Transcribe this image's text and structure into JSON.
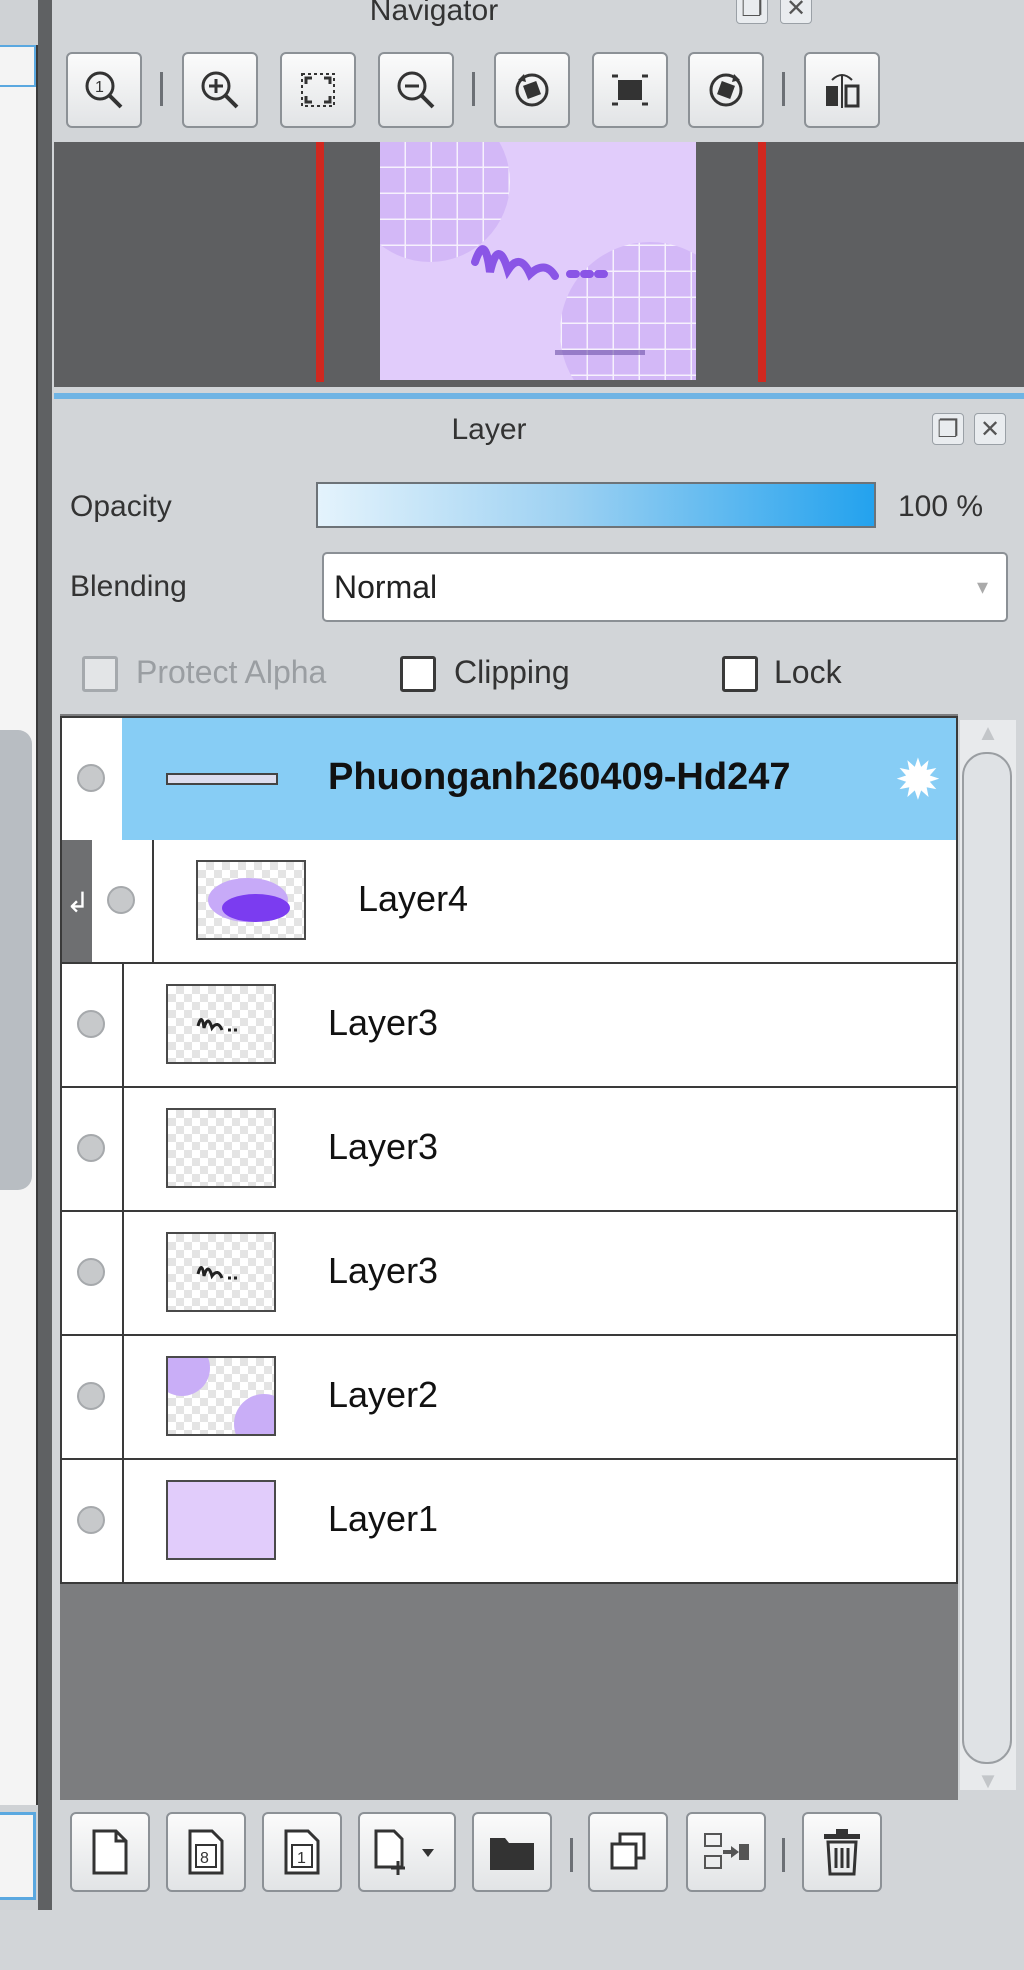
{
  "navigator": {
    "title": "Navigator",
    "toolbar": [
      {
        "name": "zoom-actual-size-icon"
      },
      {
        "name": "zoom-in-icon"
      },
      {
        "name": "fit-to-window-icon"
      },
      {
        "name": "zoom-out-icon"
      },
      {
        "name": "rotate-left-icon"
      },
      {
        "name": "reset-rotation-icon"
      },
      {
        "name": "rotate-right-icon"
      },
      {
        "name": "flip-horizontal-icon"
      }
    ]
  },
  "layer_panel": {
    "title": "Layer",
    "opacity_label": "Opacity",
    "opacity_value": "100 %",
    "opacity_fraction": 1.0,
    "blending_label": "Blending",
    "blending_value": "Normal",
    "protect_alpha_label": "Protect Alpha",
    "clipping_label": "Clipping",
    "lock_label": "Lock",
    "layers": [
      {
        "name": "Phuonganh260409-Hd247",
        "selected": true
      },
      {
        "name": "Layer4",
        "clipped": true
      },
      {
        "name": "Layer3"
      },
      {
        "name": "Layer3"
      },
      {
        "name": "Layer3"
      },
      {
        "name": "Layer2"
      },
      {
        "name": "Layer1"
      }
    ],
    "bottom_toolbar": [
      {
        "name": "new-layer-icon"
      },
      {
        "name": "new-8bit-layer-icon"
      },
      {
        "name": "new-1bit-layer-icon"
      },
      {
        "name": "add-special-layer-icon"
      },
      {
        "name": "new-folder-icon"
      },
      {
        "name": "duplicate-layer-icon"
      },
      {
        "name": "merge-down-icon"
      },
      {
        "name": "delete-layer-icon"
      }
    ]
  },
  "colors": {
    "selection": "#87cdf5",
    "accent_border": "#6fb4e4",
    "canvas_bg": "#e1ccfb",
    "viewport_red": "#d0281f"
  }
}
